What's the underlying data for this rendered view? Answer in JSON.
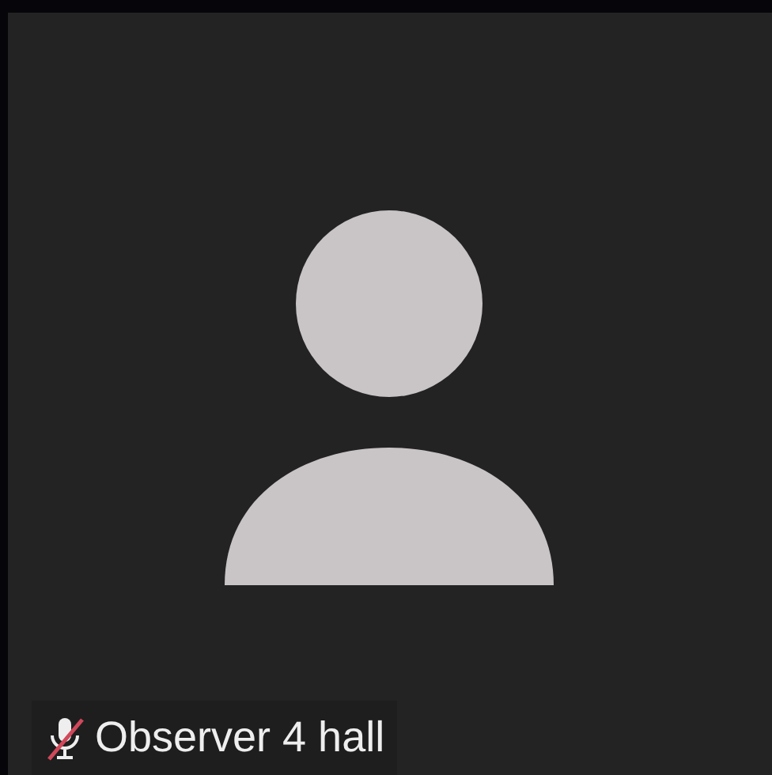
{
  "participant": {
    "name": "Observer 4 hall",
    "muted": true
  }
}
